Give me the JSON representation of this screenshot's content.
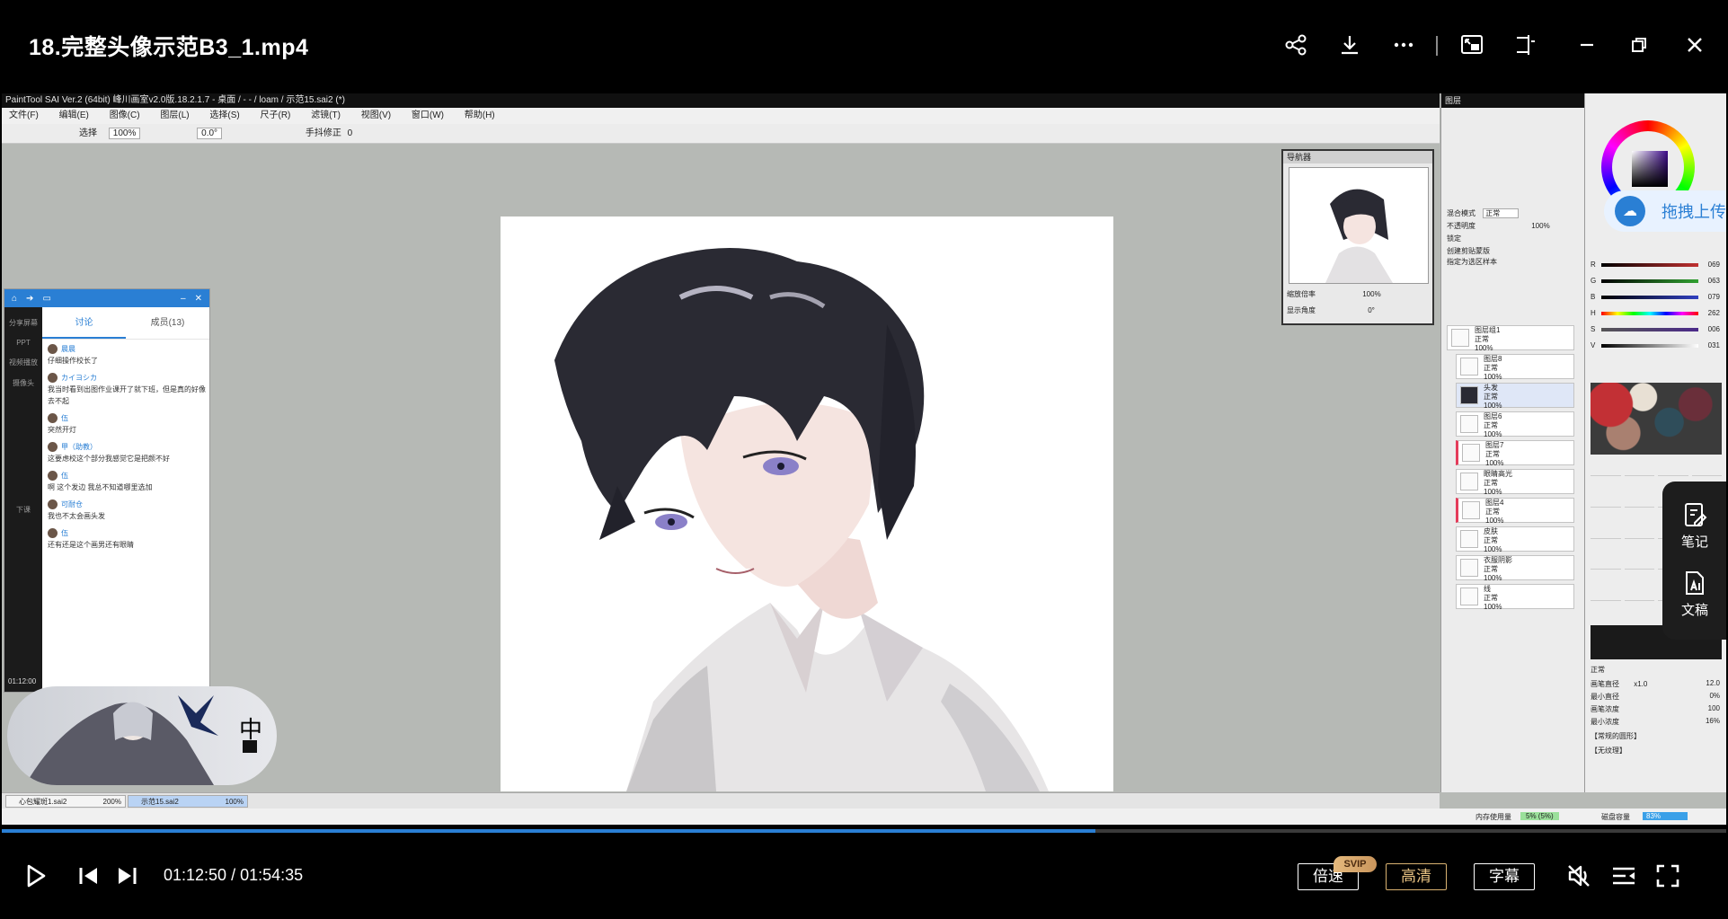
{
  "window": {
    "title": "18.完整头像示范B3_1.mp4"
  },
  "sai": {
    "title": "PaintTool SAI Ver.2 (64bit) 峰川画室v2.0版.18.2.1.7 - 桌面 / - - / loam / 示范15.sai2 (*)",
    "menu": [
      "文件(F)",
      "编辑(E)",
      "图像(C)",
      "图层(L)",
      "选择(S)",
      "尺子(R)",
      "滤镜(T)",
      "视图(V)",
      "窗口(W)",
      "帮助(H)"
    ],
    "toolbar": {
      "select_label": "选择",
      "zoom": "100%",
      "angle": "0.0°",
      "stabilizer_label": "手抖修正",
      "stabilizer_value": "0"
    },
    "navigator": {
      "title": "导航器",
      "zoom_label": "缩放倍率",
      "zoom_value": "100%",
      "angle_label": "显示角度",
      "angle_value": "0°"
    },
    "layers_title": "图层",
    "layers": [
      {
        "name": "图层组1",
        "mode": "正常",
        "opacity": "100%"
      },
      {
        "name": "图层8",
        "mode": "正常",
        "opacity": "100%"
      },
      {
        "name": "头发",
        "mode": "正常",
        "opacity": "100%"
      },
      {
        "name": "图层6",
        "mode": "正常",
        "opacity": "100%"
      },
      {
        "name": "图层7",
        "mode": "正常",
        "opacity": "100%"
      },
      {
        "name": "眼睛高光",
        "mode": "正常",
        "opacity": "100%"
      },
      {
        "name": "图层4",
        "mode": "正常",
        "opacity": "100%"
      },
      {
        "name": "皮肤",
        "mode": "正常",
        "opacity": "100%"
      },
      {
        "name": "衣服阴影",
        "mode": "正常",
        "opacity": "100%"
      },
      {
        "name": "线",
        "mode": "正常",
        "opacity": "100%"
      }
    ],
    "layer_props": {
      "blend_label": "混合模式",
      "blend_value": "正常",
      "opacity_label": "不透明度",
      "opacity_value": "100%",
      "lock_label": "锁定",
      "clip_label": "创建剪贴蒙版",
      "ref_label": "指定为选区样本"
    },
    "color_sliders": [
      {
        "label": "R",
        "value": "069",
        "color": "#c03030"
      },
      {
        "label": "G",
        "value": "063",
        "color": "#30a030"
      },
      {
        "label": "B",
        "value": "079",
        "color": "#3040c0"
      },
      {
        "label": "H",
        "value": "262",
        "color": "#d040d0"
      },
      {
        "label": "S",
        "value": "006",
        "color": "#808080"
      },
      {
        "label": "V",
        "value": "031",
        "color": "#404040"
      }
    ],
    "brush": {
      "mode": "正常",
      "size_label": "画笔直径",
      "size_scale": "x1.0",
      "size_value": "12.0",
      "min_size_label": "最小直径",
      "min_size_value": "0%",
      "density_label": "画笔浓度",
      "density_value": "100",
      "min_density_label": "最小浓度",
      "min_density_value": "16%",
      "shape_label": "【常规的圆形】",
      "texture_label": "【无纹理】"
    },
    "tabs": [
      {
        "name": "心包耀斑1.sai2",
        "zoom": "200%"
      },
      {
        "name": "示范15.sai2",
        "zoom": "100%"
      }
    ],
    "status": {
      "memory_label": "内存使用量",
      "memory_value": "5% (5%)",
      "disk_label": "磁盘容量",
      "disk_value": "83%"
    }
  },
  "chat": {
    "tabs": [
      "讨论",
      "成员(13)"
    ],
    "side": [
      "分享屏幕",
      "PPT",
      "视频播放",
      "摄像头",
      "下课"
    ],
    "messages": [
      {
        "user": "晨晨",
        "text": "仔细操作校长了"
      },
      {
        "user": "カイヨシカ",
        "text": "我当时看到出图作业课开了就下班，但是真的好像去不起"
      },
      {
        "user": "伍",
        "text": "突然开灯"
      },
      {
        "user": "甲（助教）",
        "text": "这要虑校这个部分我感觉它是把颜不好"
      },
      {
        "user": "伍",
        "text": "啊 这个发边 我总不知道哪里选加"
      },
      {
        "user": "可耐仓",
        "text": "我也不太会画头发"
      },
      {
        "user": "伍",
        "text": "还有还是这个画男还有眼睛"
      }
    ],
    "time": "01:12:00"
  },
  "overlay": {
    "zh_badge": "中",
    "upload_label": "拖拽上传",
    "notes_label": "笔记",
    "draft_label": "文稿"
  },
  "player": {
    "current": "01:12:50",
    "total": "01:54:35",
    "progress": 0.634,
    "speed_label": "倍速",
    "svip_label": "SVIP",
    "quality_label": "高清",
    "subtitle_label": "字幕"
  }
}
